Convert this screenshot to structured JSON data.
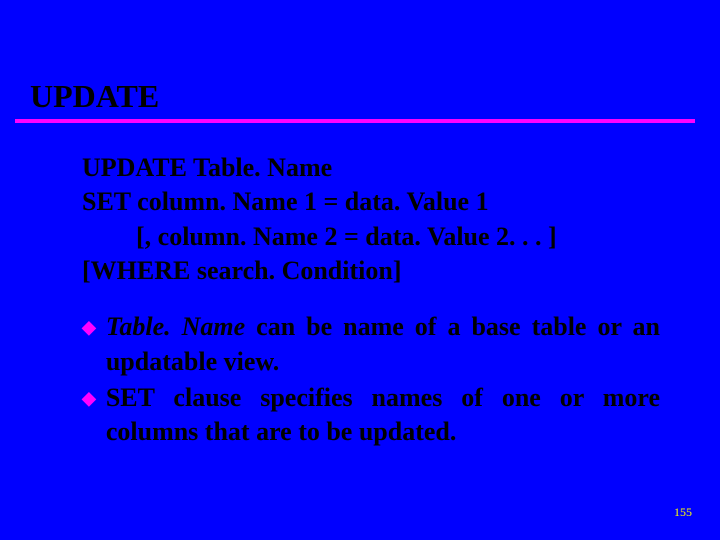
{
  "title": "UPDATE",
  "syntax": {
    "line1": "UPDATE Table. Name",
    "line2": "SET column. Name 1 = data. Value 1",
    "line3": "[, column. Name 2 = data. Value 2. . . ]",
    "line4": "[WHERE search. Condition]"
  },
  "bullets": [
    {
      "lead_italic": "Table. Name",
      "rest": " can be name of a base table or an updatable view."
    },
    {
      "lead_italic": "",
      "rest": "SET clause specifies names of one or more columns that are to be updated."
    }
  ],
  "pagenum": "155"
}
